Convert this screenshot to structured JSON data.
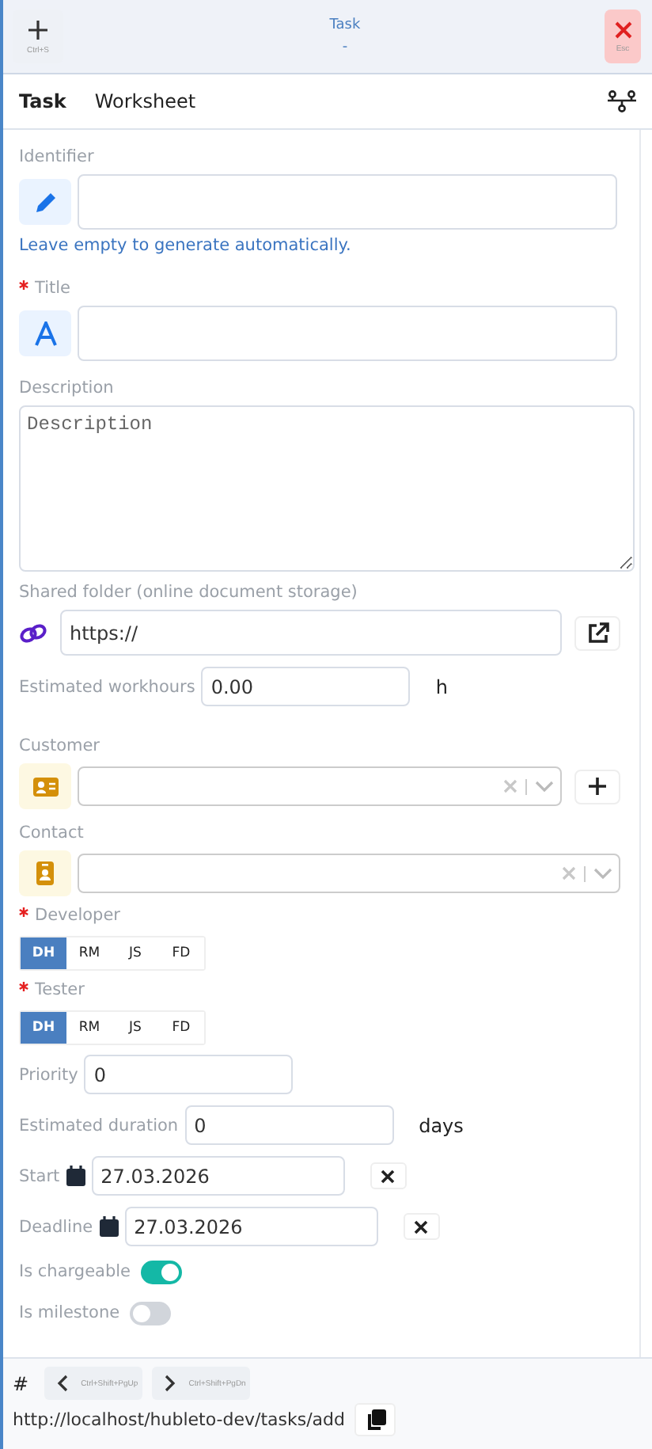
{
  "header": {
    "add_shortcut": "Ctrl+S",
    "title": "Task",
    "subtitle": "-",
    "close_shortcut": "Esc"
  },
  "tabs": [
    {
      "label": "Task",
      "selected": true
    },
    {
      "label": "Worksheet",
      "selected": false
    }
  ],
  "identifier": {
    "label": "Identifier",
    "required": false,
    "hint": "Leave empty to generate automatically."
  },
  "title": {
    "label": "Title",
    "required": true
  },
  "description": {
    "label": "Description",
    "required": false,
    "placeholder": "Description"
  },
  "shared_folder": {
    "label": "Shared folder (online document storage)",
    "required": false,
    "value": "https://"
  },
  "estimated_workhours": {
    "label": "Estimated workhours",
    "value": "0.00",
    "unit": "h"
  },
  "customer": {
    "label": "Customer",
    "required": false
  },
  "contact": {
    "label": "Contact",
    "required": false
  },
  "developer": {
    "label": "Developer",
    "required": true,
    "options": [
      {
        "label": "DH",
        "selected": true
      },
      {
        "label": "RM",
        "selected": false
      },
      {
        "label": "JS",
        "selected": false
      },
      {
        "label": "FD",
        "selected": false
      }
    ]
  },
  "tester": {
    "label": "Tester",
    "required": true,
    "options": [
      {
        "label": "DH",
        "selected": true
      },
      {
        "label": "RM",
        "selected": false
      },
      {
        "label": "JS",
        "selected": false
      },
      {
        "label": "FD",
        "selected": false
      }
    ]
  },
  "priority": {
    "label": "Priority",
    "value": "0"
  },
  "estimated_duration": {
    "label": "Estimated duration",
    "value": "0",
    "unit": "days"
  },
  "start": {
    "label": "Start",
    "value": "27.03.2026"
  },
  "deadline": {
    "label": "Deadline",
    "value": "27.03.2026"
  },
  "toggles": [
    {
      "label": "Is chargeable",
      "on": true
    },
    {
      "label": "Is milestone",
      "on": false
    }
  ],
  "footer": {
    "hash": "#",
    "prev_shortcut": "Ctrl+Shift+PgUp",
    "next_shortcut": "Ctrl+Shift+PgDn",
    "url": "http://localhost/hubleto-dev/tasks/add"
  }
}
